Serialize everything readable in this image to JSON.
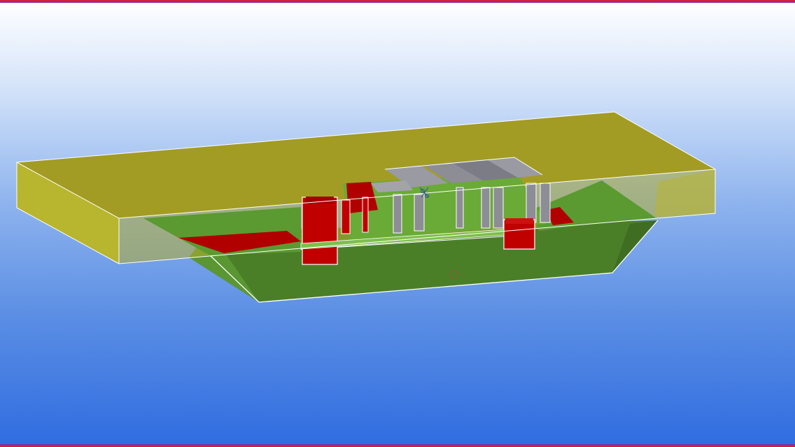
{
  "viewport": {
    "background_top": "#ffffff",
    "background_bottom": "#2f6ce0",
    "frame_color": "#d0203a"
  },
  "model": {
    "slab_color": "#a8a42a",
    "hull_color": "#4f8a2c",
    "member_color": "#c00000",
    "bulkhead_color": "#8a8a94",
    "edge_color": "#ffffff"
  },
  "cursor": {
    "icon": "pivot-cursor-icon"
  },
  "rotation_center": {
    "icon": "rotation-center-icon"
  }
}
